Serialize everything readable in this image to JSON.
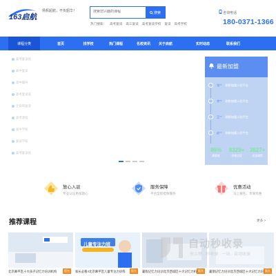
{
  "header": {
    "logo_text": "163启航",
    "slogan": "扬帆起航，不负韶华！",
    "search": {
      "placeholder": "搜索您兴趣的课程",
      "button_label": "搜索"
    },
    "hot_label": "热门搜索：",
    "hot_links": [
      "高考复读",
      "高三复读",
      "高考复读学校",
      "复读",
      "高考学校"
    ],
    "phone_label": "咨询电话",
    "phone_number": "180-0371-1366"
  },
  "nav": {
    "category_label": "课程分类",
    "items": [
      "首页",
      "找学校",
      "热门课程",
      "名校资讯",
      "关于启航",
      "实时动态",
      "联系我们"
    ]
  },
  "sidebar": {
    "items": [
      "高考复读班",
      "高中复读",
      "高中辅导",
      "高考复读班",
      "全日制复读",
      "高考课程",
      "高中学校",
      "复读学校",
      "高考复读班"
    ]
  },
  "join_panel": {
    "title": "最新加盟",
    "entries": [
      {
        "name": "张**",
        "text": "刚刚加盟入驻平台"
      },
      {
        "name": "李**",
        "text": "刚刚加盟入驻平台"
      },
      {
        "name": "王**",
        "text": "刚刚加盟入驻平台"
      },
      {
        "name": "赵**",
        "text": "刚刚加盟入驻平台"
      }
    ],
    "stats": [
      {
        "num": "96%",
        "label": "满意度"
      },
      {
        "num": "8329+",
        "label": "学校认证"
      },
      {
        "num": "3827+",
        "label": "优选课程"
      }
    ]
  },
  "features": [
    {
      "title": "放心入驻",
      "desc": "专业认证更加放心",
      "color": "#f5b51e"
    },
    {
      "title": "服务保障",
      "desc": "平台全程担保服务",
      "color": "#4f8ff0"
    },
    {
      "title": "优惠活动",
      "desc": "马上报名，享受优惠",
      "color": "#f07a7a"
    }
  ],
  "courses": {
    "title": "推荐课程",
    "more": "更多 >",
    "items": [
      {
        "title": "北京幕平区十大孩子记忆力培训机构",
        "tag": "报名"
      },
      {
        "title": "家长必看!!北京幕平区儿童专注力训练",
        "tag": "报名"
      },
      {
        "title": "暑假记忆力培训北京西城区十大记忆力机构",
        "tag": "报名"
      },
      {
        "title": "暑期记忆力培训北京西城区十大记忆力培训",
        "tag": "报名"
      }
    ],
    "banner_text": "儿童专注力班"
  },
  "watermark": {
    "text": "自动秒收录",
    "sub": "快上榜 · 秒收录 · 一站 · 自动收录"
  },
  "colors": {
    "primary": "#2c6ff1",
    "phone": "#2c6ff1",
    "accent": "#f08a24"
  }
}
